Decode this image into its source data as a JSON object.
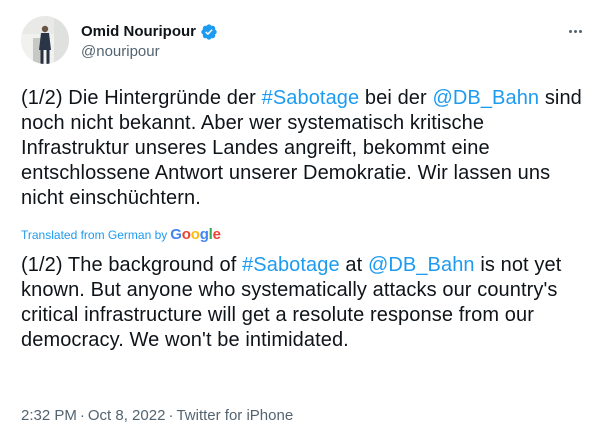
{
  "author": {
    "display_name": "Omid Nouripour",
    "handle": "@nouripour",
    "verified": true
  },
  "tweet": {
    "original_segments": [
      {
        "text": "(1/2) Die Hintergründe der ",
        "link": false
      },
      {
        "text": "#Sabotage",
        "link": true
      },
      {
        "text": " bei der ",
        "link": false
      },
      {
        "text": "@DB_Bahn",
        "link": true
      },
      {
        "text": " sind noch nicht bekannt. Aber wer systematisch kritische Infrastruktur unseres Landes angreift, bekommt eine entschlossene Antwort unserer Demokratie. Wir lassen uns nicht einschüchtern.",
        "link": false
      }
    ],
    "translated_label": "Translated from German by",
    "translator_brand": "Google",
    "translation_segments": [
      {
        "text": "(1/2) The background of ",
        "link": false
      },
      {
        "text": "#Sabotage",
        "link": true
      },
      {
        "text": " at ",
        "link": false
      },
      {
        "text": "@DB_Bahn",
        "link": true
      },
      {
        "text": " is not yet known. But anyone who systematically attacks our country's critical infrastructure will get a resolute response from our democracy. We won't be intimidated.",
        "link": false
      }
    ]
  },
  "meta": {
    "time": "2:32 PM",
    "separator": "·",
    "date": "Oct 8, 2022",
    "source": "Twitter for iPhone"
  },
  "colors": {
    "accent": "#1d9bf0",
    "text": "#0f1419",
    "secondary": "#536471",
    "google_blue": "#4285f4",
    "google_red": "#ea4335",
    "google_yellow": "#fbbc05",
    "google_green": "#34a853"
  },
  "icons": {
    "verified": "verified-badge-icon",
    "more": "more-dots-icon"
  }
}
